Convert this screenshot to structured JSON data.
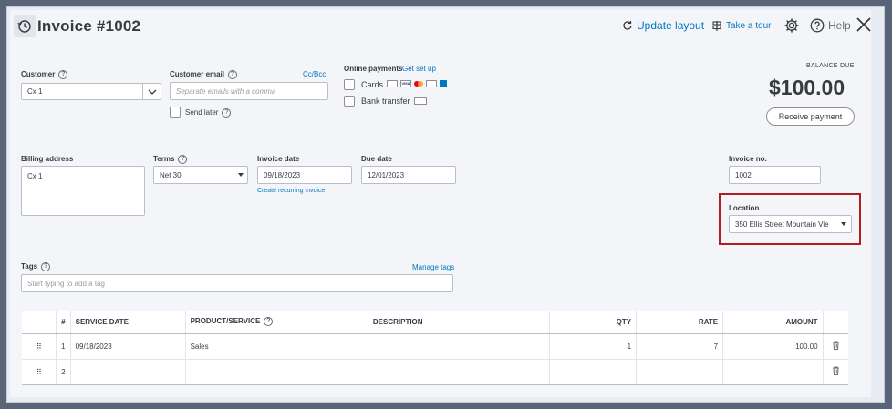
{
  "header": {
    "title": "Invoice #1002",
    "update_layout": "Update layout",
    "take_tour": "Take a tour",
    "help": "Help"
  },
  "customer": {
    "label": "Customer",
    "value": "Cx 1"
  },
  "email": {
    "label": "Customer email",
    "cc_bcc": "Cc/Bcc",
    "placeholder": "Separate emails with a comma",
    "send_later": "Send later"
  },
  "online_payments": {
    "label": "Online payments",
    "setup_link": "Get set up",
    "cards": "Cards",
    "bank_transfer": "Bank transfer"
  },
  "balance": {
    "label": "BALANCE DUE",
    "amount": "$100.00",
    "receive_payment": "Receive payment"
  },
  "billing": {
    "label": "Billing address",
    "value": "Cx 1"
  },
  "terms": {
    "label": "Terms",
    "value": "Net 30"
  },
  "invoice_date": {
    "label": "Invoice date",
    "value": "09/18/2023",
    "recurring_link": "Create recurring invoice"
  },
  "due_date": {
    "label": "Due date",
    "value": "12/01/2023"
  },
  "invoice_no": {
    "label": "Invoice no.",
    "value": "1002"
  },
  "location": {
    "label": "Location",
    "value": "350 Ellis Street Mountain Vie"
  },
  "tags": {
    "label": "Tags",
    "manage": "Manage tags",
    "placeholder": "Start typing to add a tag"
  },
  "table": {
    "headers": [
      "#",
      "SERVICE DATE",
      "PRODUCT/SERVICE",
      "DESCRIPTION",
      "QTY",
      "RATE",
      "AMOUNT"
    ],
    "rows": [
      {
        "num": "1",
        "service_date": "09/18/2023",
        "product": "Sales",
        "description": "",
        "qty": "1",
        "rate": "7",
        "amount": "100.00"
      },
      {
        "num": "2",
        "service_date": "",
        "product": "",
        "description": "",
        "qty": "",
        "rate": "",
        "amount": ""
      }
    ]
  },
  "colors": {
    "link": "#0077c5",
    "highlight": "#b01e23",
    "text": "#393a3d"
  }
}
